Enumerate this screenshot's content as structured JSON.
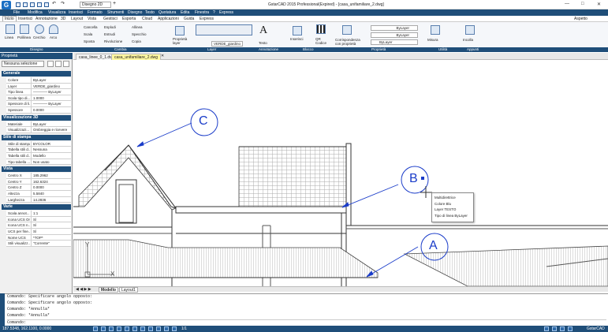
{
  "window": {
    "title": "GstarCAD 2015 Professional(Expired) - [casa_unifamiliare_2.dwg]",
    "workspace": "Disegno 2D",
    "logo": "G",
    "minimize": "—",
    "maximize": "□",
    "close": "✕"
  },
  "menu": [
    "File",
    "Modifica",
    "Visualizza",
    "Inserisci",
    "Formato",
    "Strumenti",
    "Disegno",
    "Testo",
    "Quotatura",
    "Edita",
    "Finestra",
    "?",
    "Express"
  ],
  "ribbon_tabs": [
    "Inizio",
    "Inserisci",
    "Annotazione",
    "3D",
    "Layout",
    "Vista",
    "Gestisci",
    "Esporta",
    "Cloud",
    "Applicazioni",
    "Guida",
    "Express"
  ],
  "ribbon_right": "Aspetto",
  "ribbon": {
    "draw": [
      "Linea",
      "Polilinea",
      "Cerchio",
      "Arco"
    ],
    "modify_left": [
      "Cancella",
      "Scala",
      "Sposta"
    ],
    "modify_mid": [
      "Esplodi",
      "Estrudi",
      "Rivoluzione"
    ],
    "modify_right": [
      "Allinea",
      "Specchio",
      "Copia"
    ],
    "layer_btn": "Proprietà layer",
    "layer_name": "VERDE_giardino",
    "text": "Testo",
    "insert": "Inserisci",
    "qr": "QR Codice",
    "match": "Corrispondenza con proprietà",
    "bylayer": [
      "ByLayer",
      "ByLayer",
      "ByLayer"
    ],
    "measure": "Misura",
    "paste": "Incolla"
  },
  "ribbon_groups": [
    "Disegno",
    "Cambia",
    "Layer",
    "Annotazione",
    "Blocco",
    "Proprietà",
    "Utilità",
    "Appunti"
  ],
  "properties": {
    "title": "Proprietà",
    "selection": "Nessuna selezione",
    "sections": [
      {
        "name": "Generale",
        "rows": [
          [
            "Colore",
            "ByLayer"
          ],
          [
            "Layer",
            "VERDE_giardino"
          ],
          [
            "Tipo linea",
            "———— ByLayer"
          ],
          [
            "Scala tipo di...",
            "1.0000"
          ],
          [
            "Spessore di li...",
            "———— ByLayer"
          ],
          [
            "Spessore",
            "0.0000"
          ]
        ]
      },
      {
        "name": "Visualizzazione 3D",
        "rows": [
          [
            "Materiale",
            "ByLayer"
          ],
          [
            "Visualizzazi...",
            "Ombreggia e ricevere"
          ]
        ]
      },
      {
        "name": "Stile di stampa",
        "rows": [
          [
            "Stile di stampa",
            "BYCOLOR"
          ],
          [
            "Tabella stili d...",
            "Nessuna"
          ],
          [
            "Tabella stili d...",
            "Modello"
          ],
          [
            "Tipo tabella ...",
            "Non usato"
          ]
        ]
      },
      {
        "name": "Vista",
        "rows": [
          [
            "Centro X",
            "185.2962"
          ],
          [
            "Centro Y",
            "162.6324"
          ],
          [
            "Centro Z",
            "0.0000"
          ],
          [
            "Altezza",
            "5.5840"
          ],
          [
            "Larghezza",
            "14.2836"
          ]
        ]
      },
      {
        "name": "Varie",
        "rows": [
          [
            "Scala annot...",
            "1:1"
          ],
          [
            "Icona UCS On",
            "Sì"
          ],
          [
            "Icona UCS n...",
            "Sì"
          ],
          [
            "UCS per fine...",
            "Sì"
          ],
          [
            "Nome UCS",
            "*TOP*"
          ],
          [
            "Stili visualizz...",
            "\"Corrente\""
          ]
        ]
      }
    ]
  },
  "doc_tabs": [
    "casa_linee_0_1.dwg",
    "casa_unifamiliare_2.dwg"
  ],
  "layout_tabs": [
    "Modello",
    "Layout1"
  ],
  "drawing": {
    "callouts": [
      "C",
      "B",
      "A"
    ],
    "ucs": {
      "x": "X",
      "y": "Y"
    },
    "tooltip": [
      "Multidirettrice",
      "Colore Blu",
      "Layer TESTO",
      "Tipo di linea ByLayer"
    ]
  },
  "command": [
    "Comando: Specificare angolo opposto:",
    "Comando: Specificare angolo opposto:",
    "Comando: *Annulla*",
    "Comando: *Annulla*",
    "Comando:"
  ],
  "status": {
    "coords": "187.5348, 162.1100, 0.0000",
    "right_label": "GstarCAD",
    "scale": "1/1"
  }
}
